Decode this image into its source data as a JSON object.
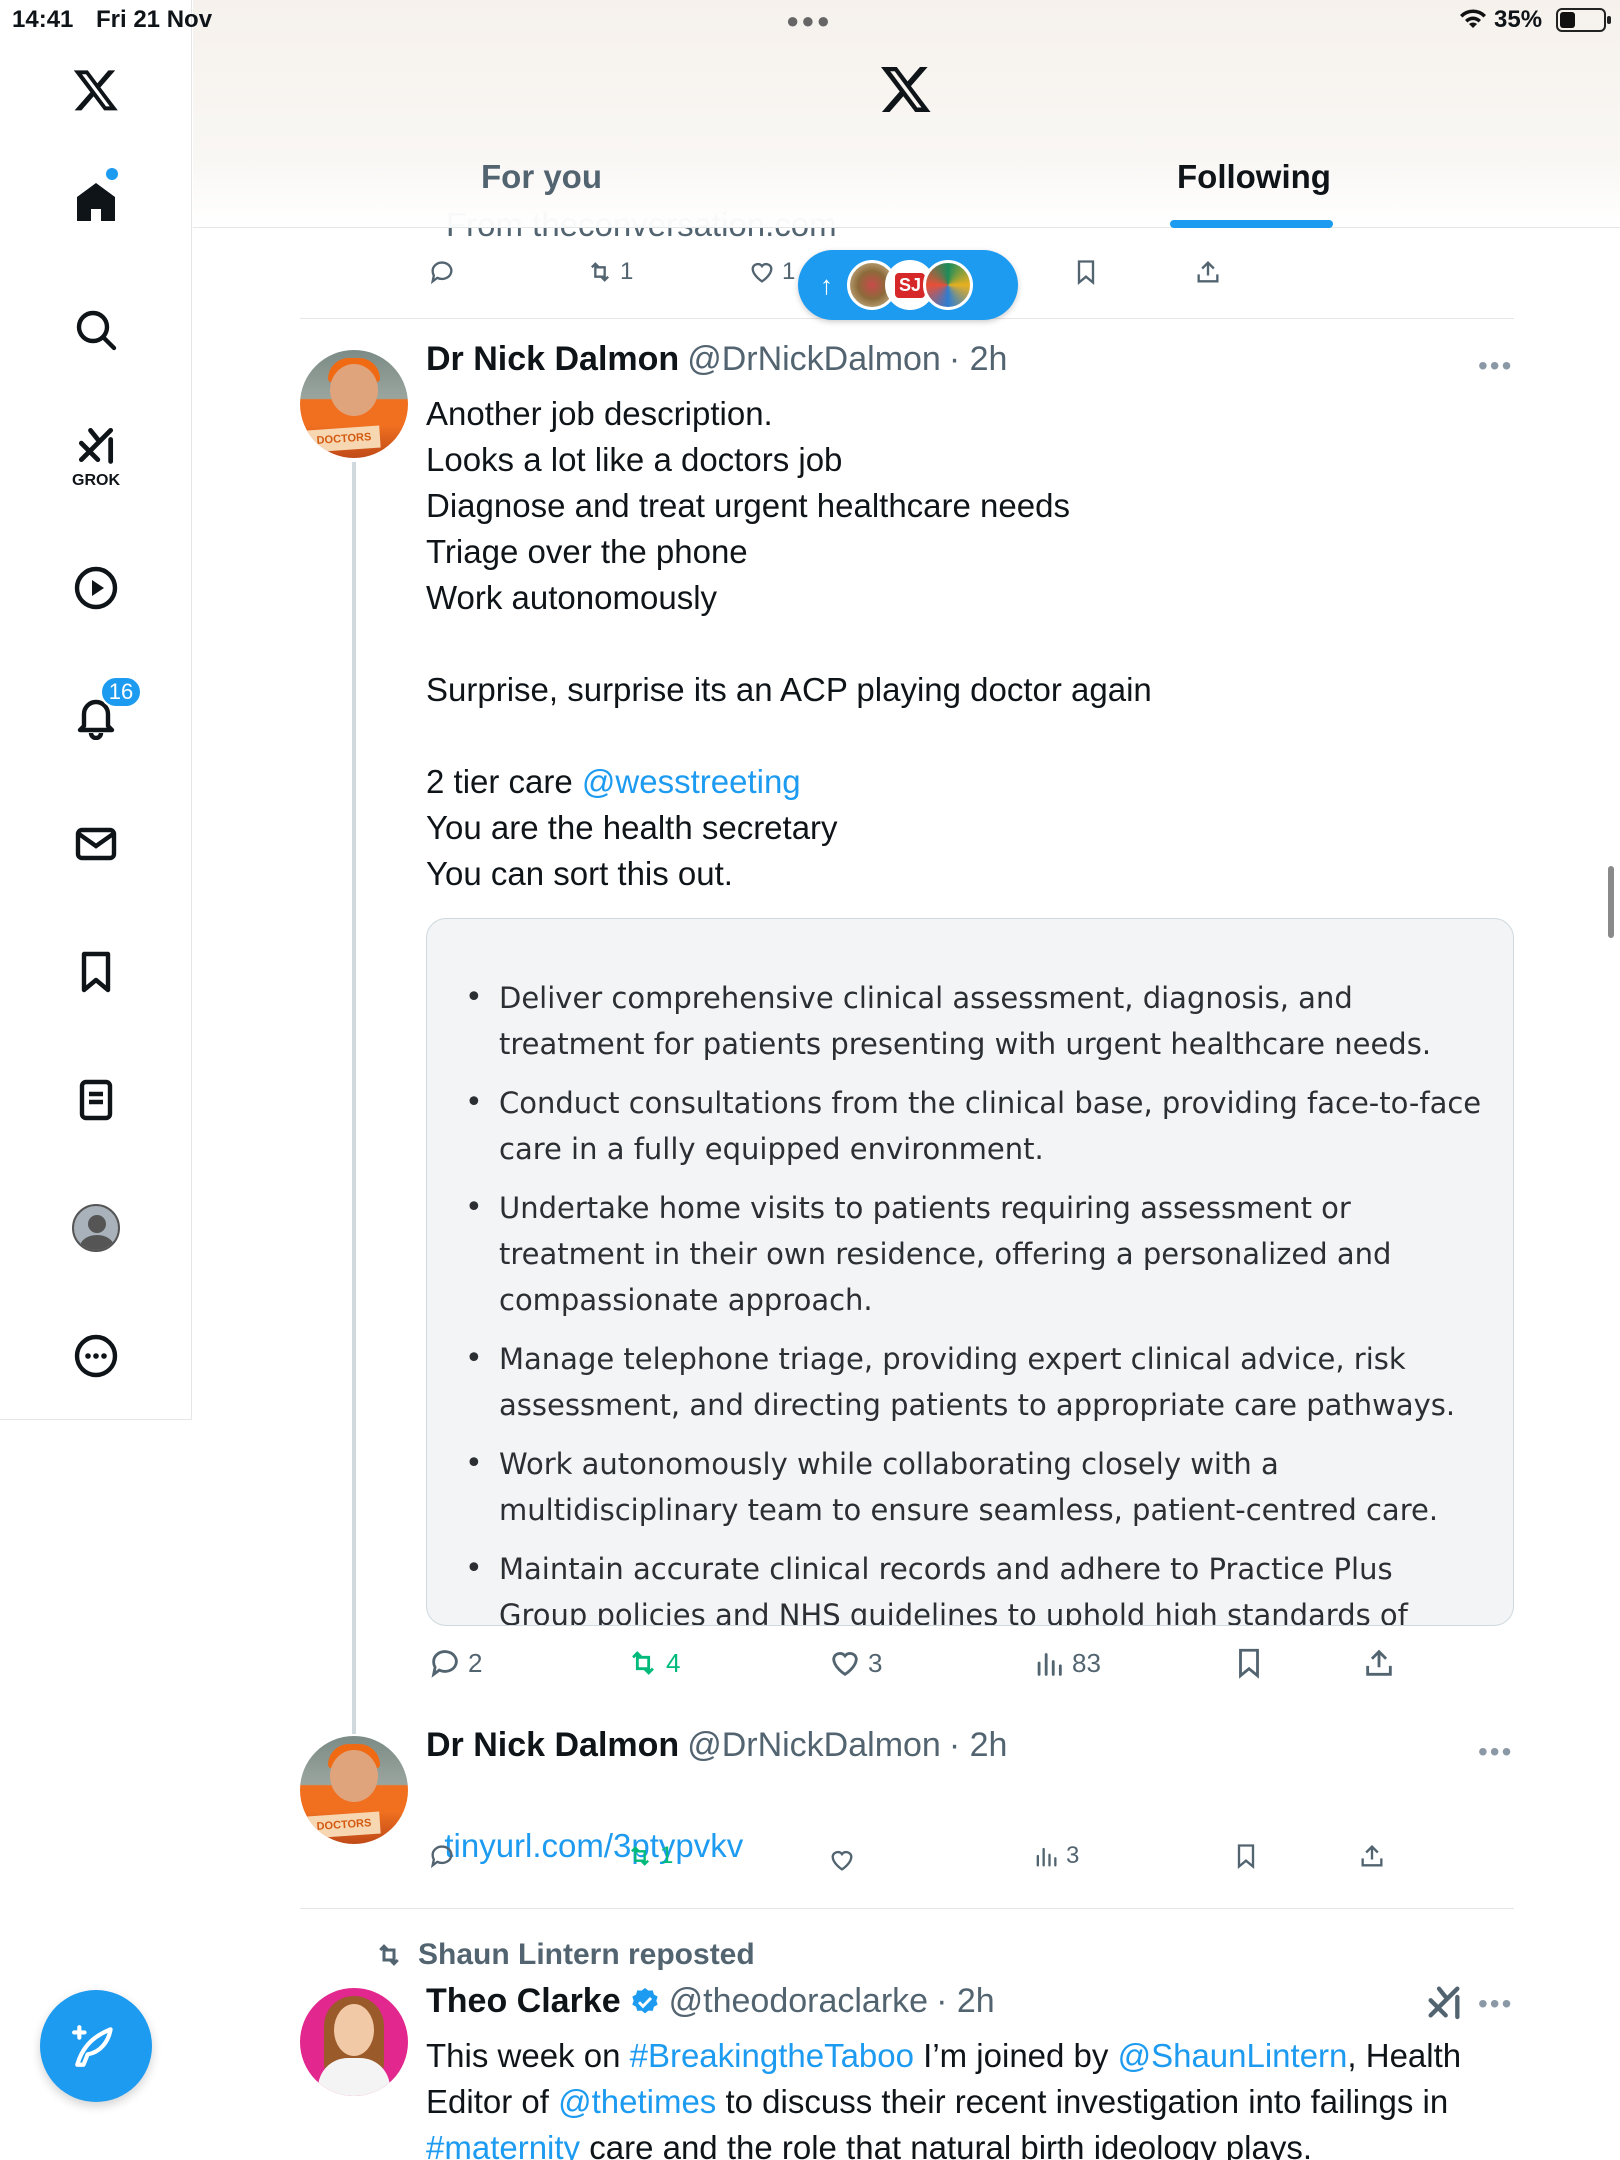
{
  "status_bar": {
    "time": "14:41",
    "date": "Fri 21 Nov",
    "battery": "35%",
    "battery_level": 0.35
  },
  "sidebar": {
    "grok_label": "GROK",
    "notification_count": "16",
    "items": [
      "home-icon",
      "search-icon",
      "grok-icon",
      "video-icon",
      "bell-icon",
      "mail-icon",
      "bookmark-icon",
      "list-icon",
      "profile-icon",
      "more-icon"
    ]
  },
  "header": {
    "tabs": [
      {
        "label": "For you"
      },
      {
        "label": "Following"
      }
    ],
    "active_tab": "Following"
  },
  "prev_tweet": {
    "source_text": "From theconversation.com",
    "reposts": "1",
    "likes": "1"
  },
  "tweet1": {
    "name": "Dr Nick Dalmon",
    "handle": "@DrNickDalmon",
    "time": "· 2h",
    "avatar_sign": "DOCTORS",
    "text_lines": [
      "Another job description.",
      "Looks a lot like a doctors job",
      "Diagnose and treat urgent healthcare needs",
      "Triage over the phone",
      "Work autonomously",
      "",
      "Surprise, surprise its an ACP playing doctor again",
      "",
      "2 tier care",
      "You are the health secretary",
      "You can sort this out."
    ],
    "mention": "@wesstreeting",
    "image_bullets": [
      "Deliver comprehensive clinical assessment, diagnosis, and treatment for patients presenting with urgent healthcare needs.",
      "Conduct consultations from the clinical base, providing face-to-face care in a fully equipped environment.",
      "Undertake home visits to patients requiring assessment or treatment in their own residence, offering a personalized and compassionate approach.",
      "Manage telephone triage, providing expert clinical advice, risk assessment, and directing patients to appropriate care pathways.",
      "Work autonomously while collaborating closely with a multidisciplinary team to ensure seamless, patient-centred care.",
      "Maintain accurate clinical records and adhere to Practice Plus Group policies and NHS guidelines to uphold high standards of care."
    ],
    "replies": "2",
    "reposts": "4",
    "likes": "3",
    "views": "83"
  },
  "tweet2": {
    "name": "Dr Nick Dalmon",
    "handle": "@DrNickDalmon",
    "time": "· 2h",
    "avatar_sign": "DOCTORS",
    "link": "tinyurl.com/3ptypvkv",
    "reposts": "1",
    "views": "3"
  },
  "tweet3": {
    "repost_label": "Shaun Lintern reposted",
    "name": "Theo Clarke",
    "handle": "@theodoraclarke",
    "time": "· 2h",
    "text_parts": [
      "This week on ",
      "#BreakingtheTaboo",
      " I’m joined by ",
      "@ShaunLintern",
      ", Health",
      "Editor of ",
      "@thetimes",
      " to discuss their recent investigation into failings in",
      "#maternity",
      " care and the role that natural birth ideology plays."
    ]
  },
  "colors": {
    "accent": "#1d9bf0",
    "repost_green": "#00ba7c",
    "text": "#0f1419",
    "muted": "#536471"
  }
}
